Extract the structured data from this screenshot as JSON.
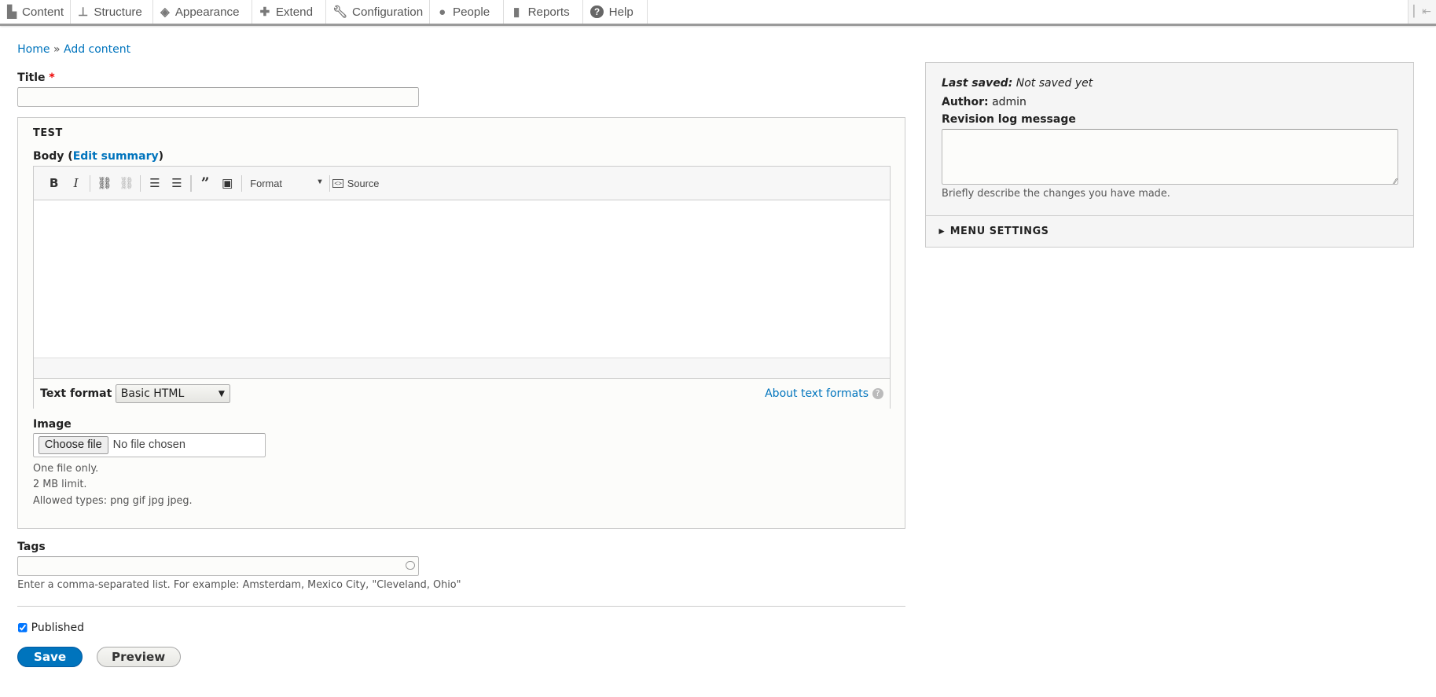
{
  "toolbar": {
    "items": [
      {
        "label": "Content",
        "icon": "file-icon"
      },
      {
        "label": "Structure",
        "icon": "sitemap-icon"
      },
      {
        "label": "Appearance",
        "icon": "paint-icon"
      },
      {
        "label": "Extend",
        "icon": "puzzle-icon"
      },
      {
        "label": "Configuration",
        "icon": "wrench-icon"
      },
      {
        "label": "People",
        "icon": "people-icon"
      },
      {
        "label": "Reports",
        "icon": "bar-chart-icon"
      },
      {
        "label": "Help",
        "icon": "help-icon"
      }
    ]
  },
  "breadcrumb": {
    "home": "Home",
    "sep": "»",
    "current": "Add content"
  },
  "title_field": {
    "label": "Title",
    "required": "*",
    "value": ""
  },
  "fieldset": {
    "legend": "TEST",
    "body": {
      "label": "Body (",
      "link": "Edit summary",
      "close": ")",
      "toolbar": {
        "format": "Format",
        "source": "Source"
      },
      "text_format_label": "Text format",
      "text_format_value": "Basic HTML",
      "about": "About text formats"
    },
    "image": {
      "label": "Image",
      "choose": "Choose file",
      "no_file": "No file chosen",
      "desc": [
        "One file only.",
        "2 MB limit.",
        "Allowed types: png gif jpg jpeg."
      ]
    }
  },
  "tags": {
    "label": "Tags",
    "value": "",
    "desc": "Enter a comma-separated list. For example: Amsterdam, Mexico City, \"Cleveland, Ohio\""
  },
  "published": {
    "label": "Published",
    "checked": true
  },
  "actions": {
    "save": "Save",
    "preview": "Preview"
  },
  "sidebar": {
    "last_saved_label": "Last saved:",
    "last_saved_value": "Not saved yet",
    "author_label": "Author:",
    "author_value": "admin",
    "revision_label": "Revision log message",
    "revision_desc": "Briefly describe the changes you have made.",
    "menu_settings": "MENU SETTINGS"
  }
}
